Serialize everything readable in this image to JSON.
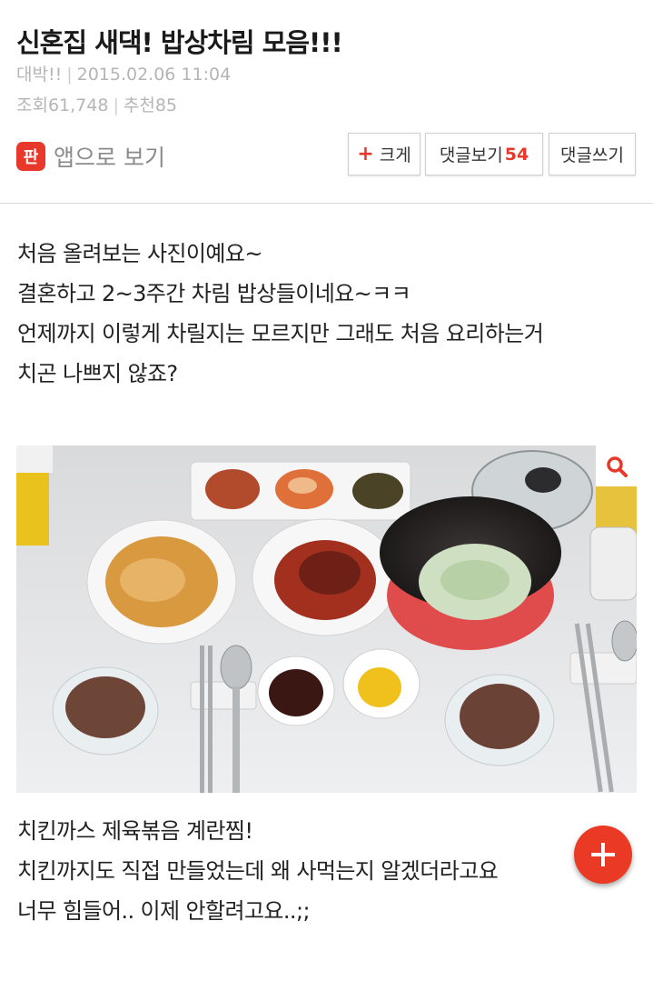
{
  "post": {
    "title": "신혼집 새댁! 밥상차림 모음!!!",
    "category": "대박!!",
    "datetime": "2015.02.06 11:04",
    "views_label": "조회",
    "views": "61,748",
    "recommend_label": "추천",
    "recommend": "85"
  },
  "toolbar": {
    "app_label": "앱으로 보기",
    "app_icon_text": "판",
    "bigger_plus": "+",
    "bigger_label": "크게",
    "view_comments_label": "댓글보기",
    "comment_count": "54",
    "write_comment_label": "댓글쓰기"
  },
  "content": {
    "intro_lines": [
      "처음 올려보는 사진이예요~",
      "결혼하고 2~3주간 차림 밥상들이네요~ㅋㅋ",
      "언제까지 이렇게 차릴지는 모르지만 그래도 처음 요리하는거",
      "치곤 나쁘지 않죠?"
    ],
    "photo_caption_lines": [
      "치킨까스 제육볶음 계란찜!",
      "치킨까지도 직접 만들었는데 왜 사먹는지 알겠더라고요",
      "너무 힘들어.. 이제 안할려고요..;;"
    ]
  },
  "icons": {
    "app": "app-logo-icon",
    "zoom": "search-icon",
    "fab": "plus-icon"
  },
  "colors": {
    "accent": "#e8382b",
    "meta_text": "#b5b5b5",
    "body_text": "#222222"
  }
}
